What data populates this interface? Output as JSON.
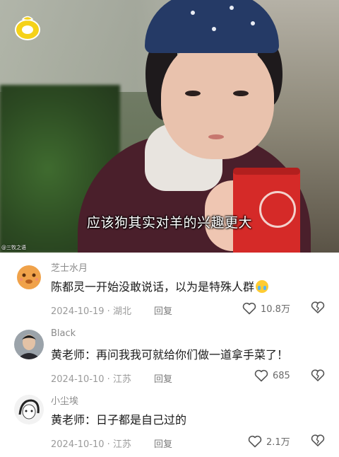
{
  "video": {
    "subtitle": "应该狗其实对羊的兴趣更大",
    "watermark": "@三牧之语"
  },
  "comments": [
    {
      "username": "芝士水月",
      "text": "陈都灵一开始没敢说话，以为是特殊人群",
      "emoji": "crying-face",
      "date_location": "2024-10-19 · 湖北",
      "reply_label": "回复",
      "likes": "10.8万",
      "avatar": "cartoon-avatar"
    },
    {
      "username": "Black",
      "text": "黄老师：再问我我可就给你们做一道拿手菜了！",
      "date_location": "2024-10-10 · 江苏",
      "reply_label": "回复",
      "likes": "685",
      "avatar": "man-avatar"
    },
    {
      "username": "小尘埃",
      "text": "黄老师：日子都是自己过的",
      "date_location": "2024-10-10 · 江苏",
      "reply_label": "回复",
      "likes": "2.1万",
      "avatar": "sketch-avatar"
    }
  ],
  "colors": {
    "username": "#8a8a8a",
    "text": "#1a1a1a",
    "meta": "#9a9a9a"
  }
}
